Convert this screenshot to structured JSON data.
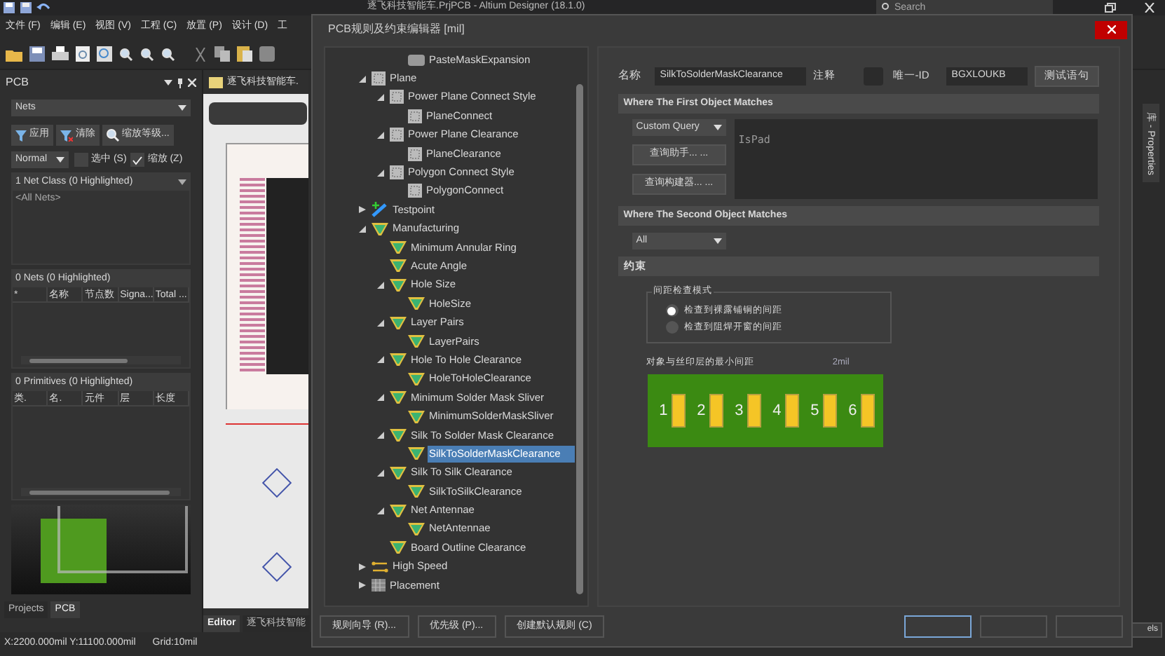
{
  "app": {
    "title": "逐飞科技智能车.PrjPCB - Altium Designer (18.1.0)",
    "search_placeholder": "Search",
    "menu": [
      "文件 (F)",
      "编辑 (E)",
      "视图 (V)",
      "工程 (C)",
      "放置 (P)",
      "设计 (D)",
      "工"
    ]
  },
  "pcb_panel": {
    "title": "PCB",
    "mode": "Nets",
    "buttons": [
      {
        "label": "应用",
        "kind": "filter"
      },
      {
        "label": "清除",
        "kind": "clear"
      },
      {
        "label": "缩放等级...",
        "kind": "zoom"
      }
    ],
    "highlight_mode": "Normal",
    "checkboxes": [
      {
        "label": "选中 (S)",
        "checked": false
      },
      {
        "label": "缩放 (Z)",
        "checked": true
      }
    ],
    "net_class_header": "1 Net Class (0 Highlighted)",
    "net_classes": [
      "<All Nets>"
    ],
    "nets_header": "0 Nets (0 Highlighted)",
    "nets_columns": [
      "*",
      "名称",
      "节点数",
      "Signa...",
      "Total ..."
    ],
    "primitives_header": "0 Primitives (0 Highlighted)",
    "primitives_columns": [
      "类.",
      "名.",
      "元件",
      "层",
      "长度"
    ],
    "tabs": [
      {
        "label": "Projects",
        "selected": false
      },
      {
        "label": "PCB",
        "selected": true
      }
    ]
  },
  "editor": {
    "document_tab": "逐飞科技智能车.",
    "tabs": [
      {
        "label": "Editor",
        "selected": true
      },
      {
        "label": "逐飞科技智能",
        "selected": false
      }
    ]
  },
  "status_bar": {
    "coordinates": "X:2200.000mil Y:11100.000mil",
    "grid": "Grid:10mil"
  },
  "side_tab": "库 - Properties",
  "panels_button": "els",
  "dialog": {
    "title": "PCB规则及约束编辑器 [mil]",
    "tree_leading_item": {
      "label": "PasteMaskExpansion",
      "kind": "mask"
    },
    "tree": [
      {
        "label": "Plane",
        "kind": "plane",
        "expanded": true,
        "children": [
          {
            "label": "Power Plane Connect Style",
            "kind": "plane",
            "expanded": true,
            "children": [
              {
                "label": "PlaneConnect",
                "kind": "plane",
                "selected": false
              }
            ]
          },
          {
            "label": "Power Plane Clearance",
            "kind": "plane",
            "expanded": true,
            "children": [
              {
                "label": "PlaneClearance",
                "kind": "plane",
                "selected": false
              }
            ]
          },
          {
            "label": "Polygon Connect Style",
            "kind": "plane",
            "expanded": true,
            "children": [
              {
                "label": "PolygonConnect",
                "kind": "plane",
                "selected": false
              }
            ]
          }
        ]
      },
      {
        "label": "Testpoint",
        "kind": "testpoint",
        "expanded": false
      },
      {
        "label": "Manufacturing",
        "kind": "manufacturing",
        "expanded": true,
        "children": [
          {
            "label": "Minimum Annular Ring",
            "kind": "manufacturing",
            "selected": false
          },
          {
            "label": "Acute Angle",
            "kind": "manufacturing",
            "selected": false
          },
          {
            "label": "Hole Size",
            "kind": "manufacturing",
            "expanded": true,
            "children": [
              {
                "label": "HoleSize",
                "kind": "manufacturing",
                "selected": false
              }
            ]
          },
          {
            "label": "Layer Pairs",
            "kind": "manufacturing",
            "expanded": true,
            "children": [
              {
                "label": "LayerPairs",
                "kind": "manufacturing",
                "selected": false
              }
            ]
          },
          {
            "label": "Hole To Hole Clearance",
            "kind": "manufacturing",
            "expanded": true,
            "children": [
              {
                "label": "HoleToHoleClearance",
                "kind": "manufacturing",
                "selected": false
              }
            ]
          },
          {
            "label": "Minimum Solder Mask Sliver",
            "kind": "manufacturing",
            "expanded": true,
            "children": [
              {
                "label": "MinimumSolderMaskSliver",
                "kind": "manufacturing",
                "selected": false
              }
            ]
          },
          {
            "label": "Silk To Solder Mask Clearance",
            "kind": "manufacturing",
            "expanded": true,
            "children": [
              {
                "label": "SilkToSolderMaskClearance",
                "kind": "manufacturing",
                "selected": true
              }
            ]
          },
          {
            "label": "Silk To Silk Clearance",
            "kind": "manufacturing",
            "expanded": true,
            "children": [
              {
                "label": "SilkToSilkClearance",
                "kind": "manufacturing",
                "selected": false
              }
            ]
          },
          {
            "label": "Net Antennae",
            "kind": "manufacturing",
            "expanded": true,
            "children": [
              {
                "label": "NetAntennae",
                "kind": "manufacturing",
                "selected": false
              }
            ]
          },
          {
            "label": "Board Outline Clearance",
            "kind": "manufacturing",
            "selected": false
          }
        ]
      },
      {
        "label": "High Speed",
        "kind": "highspeed",
        "expanded": false
      },
      {
        "label": "Placement",
        "kind": "placement",
        "expanded": false
      }
    ],
    "name_label": "名称",
    "name_value": "SilkToSolderMaskClearance",
    "comment_label": "注释",
    "id_label": "唯一-ID",
    "id_value": "BGXLOUKB",
    "test_button": "测试语句",
    "first_header": "Where The First Object Matches",
    "first_scope": "Custom Query",
    "query_buttons": [
      "查询助手... ...",
      "查询构建器... ..."
    ],
    "query": "IsPad",
    "second_header": "Where The Second Object Matches",
    "second_scope": "All",
    "constraints_header": "约束",
    "mode_group": "间距检查模式",
    "modes": [
      {
        "label": "检查到裸露铺铜的间距",
        "selected": true
      },
      {
        "label": "检查到阻焊开窗的间距",
        "selected": false
      }
    ],
    "min_gap_label": "对象与丝印层的最小间距",
    "min_gap_value": "2mil",
    "pad_labels": [
      "1",
      "2",
      "3",
      "4",
      "5",
      "6"
    ],
    "bottom_buttons": [
      "规则向导 (R)...",
      "优先级 (P)...",
      "创建默认规则 (C)"
    ]
  }
}
